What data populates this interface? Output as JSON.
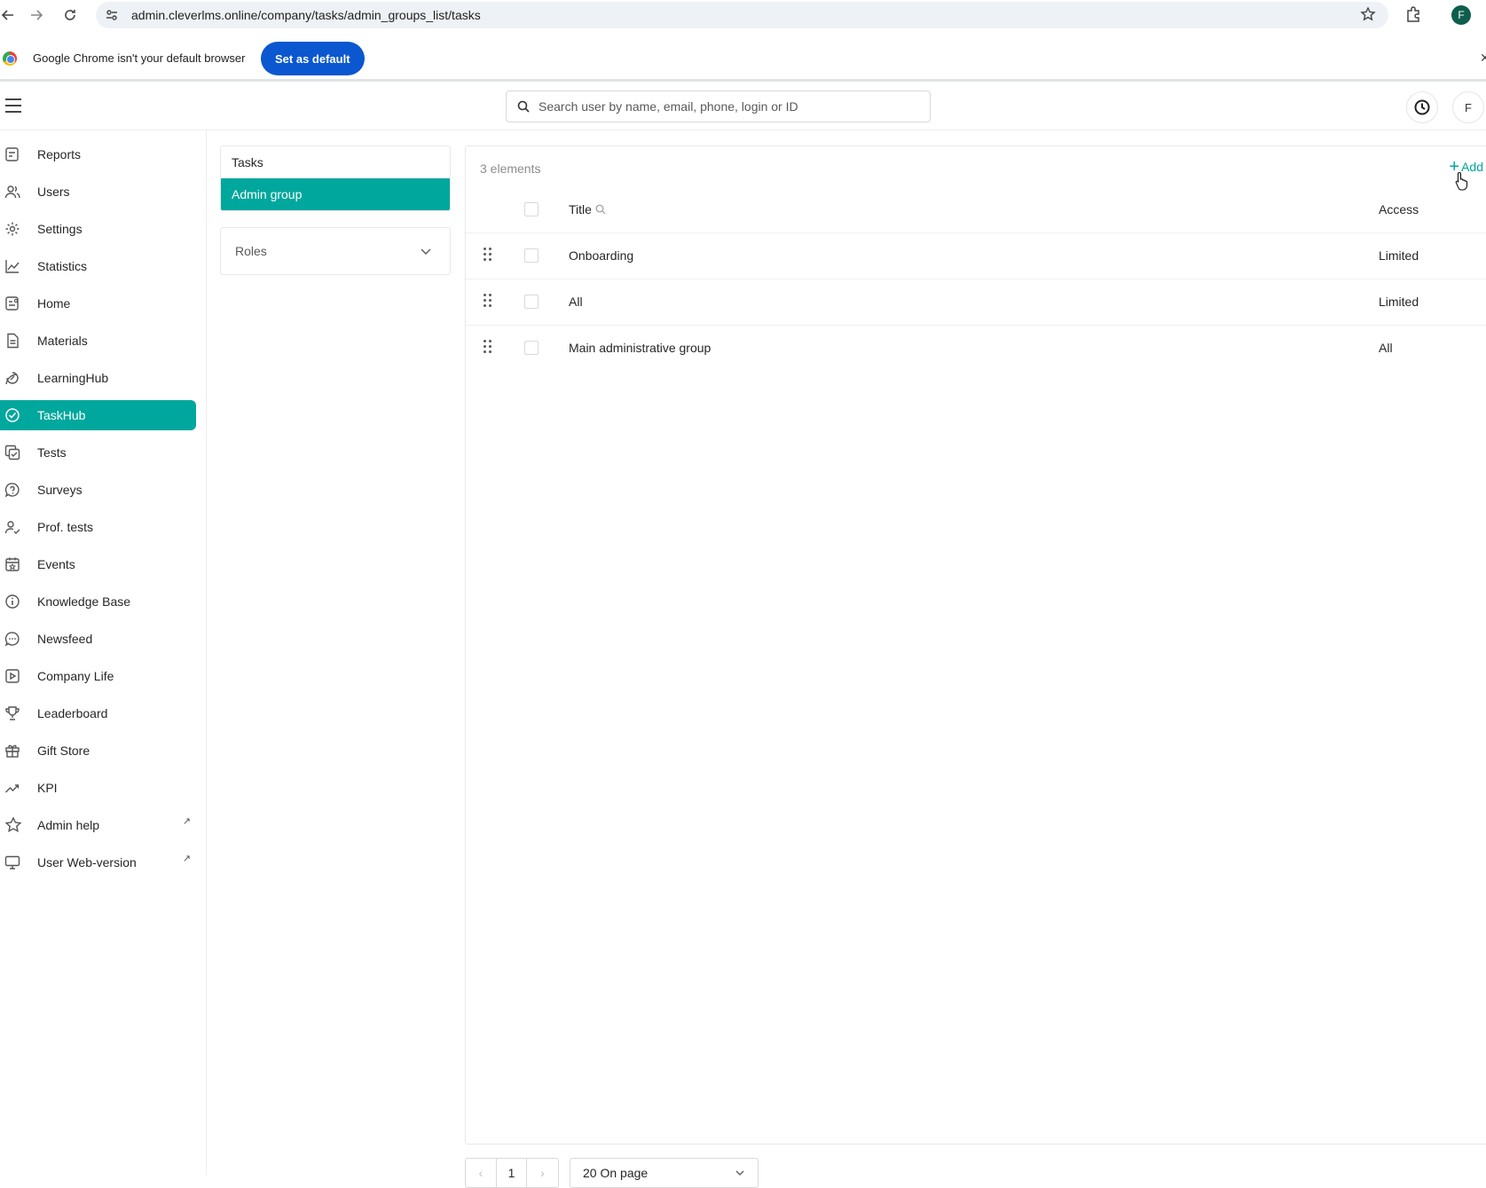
{
  "browser": {
    "url": "admin.cleverlms.online/company/tasks/admin_groups_list/tasks",
    "profile_initial": "F"
  },
  "infobar": {
    "message": "Google Chrome isn't your default browser",
    "button_label": "Set as default"
  },
  "header": {
    "search_placeholder": "Search user by name, email, phone, login or ID",
    "avatar_initial": "F"
  },
  "sidebar": {
    "items": [
      {
        "label": "Reports",
        "icon": "reports-icon"
      },
      {
        "label": "Users",
        "icon": "users-icon"
      },
      {
        "label": "Settings",
        "icon": "gear-icon"
      },
      {
        "label": "Statistics",
        "icon": "line-chart-icon"
      },
      {
        "label": "Home",
        "icon": "home-icon"
      },
      {
        "label": "Materials",
        "icon": "document-icon"
      },
      {
        "label": "LearningHub",
        "icon": "learning-icon"
      },
      {
        "label": "TaskHub",
        "icon": "check-circle-icon",
        "active": true
      },
      {
        "label": "Tests",
        "icon": "tests-icon"
      },
      {
        "label": "Surveys",
        "icon": "question-bubble-icon"
      },
      {
        "label": "Prof. tests",
        "icon": "user-check-icon"
      },
      {
        "label": "Events",
        "icon": "calendar-icon"
      },
      {
        "label": "Knowledge Base",
        "icon": "info-icon"
      },
      {
        "label": "Newsfeed",
        "icon": "chat-icon"
      },
      {
        "label": "Company Life",
        "icon": "play-icon"
      },
      {
        "label": "Leaderboard",
        "icon": "trophy-icon"
      },
      {
        "label": "Gift Store",
        "icon": "gift-icon"
      },
      {
        "label": "KPI",
        "icon": "trend-icon"
      },
      {
        "label": "Admin help",
        "icon": "star-icon",
        "external": true
      },
      {
        "label": "User Web-version",
        "icon": "monitor-icon",
        "external": true
      }
    ]
  },
  "subnav": {
    "tasks_label": "Tasks",
    "admin_group_label": "Admin group",
    "roles_label": "Roles"
  },
  "table": {
    "count_label": "3 elements",
    "add_label": "Add",
    "columns": {
      "title": "Title",
      "access": "Access"
    },
    "rows": [
      {
        "title": "Onboarding",
        "access": "Limited"
      },
      {
        "title": "All",
        "access": "Limited"
      },
      {
        "title": "Main administrative group",
        "access": "All"
      }
    ]
  },
  "pagination": {
    "current_page": "1",
    "page_size_label": "20 On page"
  }
}
